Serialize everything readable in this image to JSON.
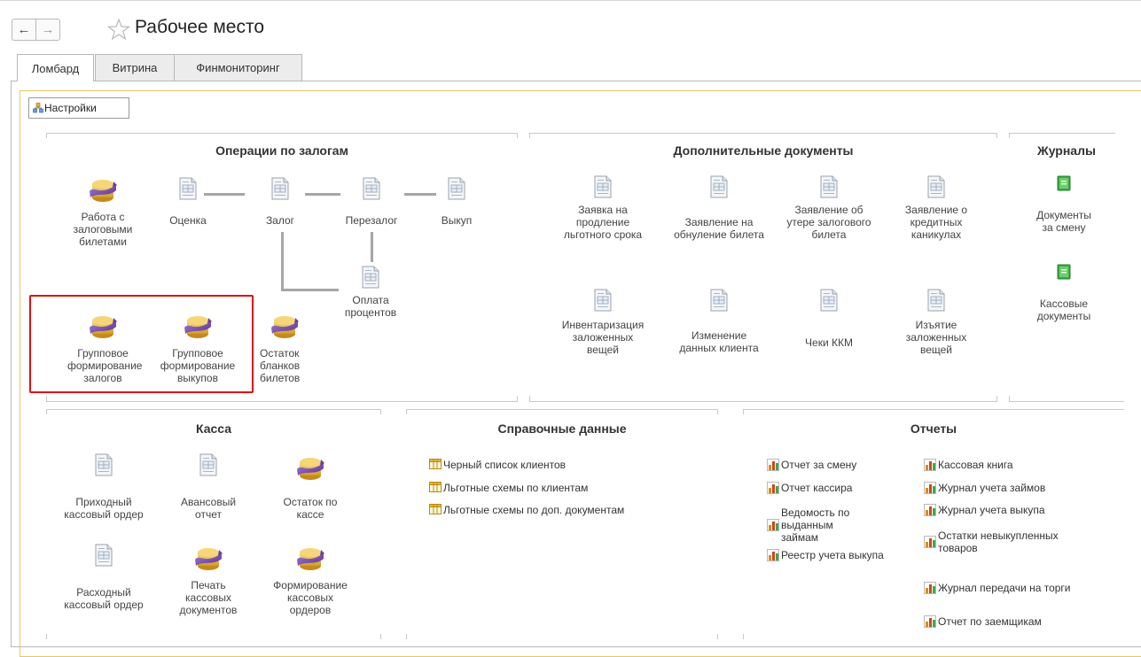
{
  "window": {
    "title": "Рабочее место"
  },
  "tabs": [
    {
      "label": "Ломбард"
    },
    {
      "label": "Витрина"
    },
    {
      "label": "Финмониторинг"
    }
  ],
  "settings_button": "Настройки",
  "operations": {
    "title": "Операции по залогам",
    "items": {
      "work_tickets": "Работа с залоговыми билетами",
      "valuation": "Оценка",
      "pledge": "Залог",
      "repledge": "Перезалог",
      "buyout": "Выкуп",
      "interest_payment": "Оплата процентов",
      "group_pledges": "Групповое формирование залогов",
      "group_buyouts": "Групповое формирование выкупов",
      "blank_remainder": "Остаток бланков билетов"
    }
  },
  "additional_docs": {
    "title": "Дополнительные документы",
    "items": {
      "grace_extension": "Заявка на продление льготного срока",
      "ticket_reset": "Заявление на обнуление билета",
      "ticket_loss": "Заявление об утере залогового билета",
      "credit_holidays": "Заявление о кредитных каникулах",
      "inventory": "Инвентаризация заложенных вещей",
      "client_change": "Изменение данных клиента",
      "kkm_receipts": "Чеки ККМ",
      "seizure": "Изъятие заложенных вещей"
    }
  },
  "journals": {
    "title": "Журналы",
    "items": {
      "shift_docs": "Документы за смену",
      "cash_docs": "Кассовые документы"
    }
  },
  "cash": {
    "title": "Касса",
    "items": {
      "incoming_order": "Приходный кассовый ордер",
      "advance_report": "Авансовый отчет",
      "cash_balance": "Остаток по кассе",
      "outgoing_order": "Расходный кассовый ордер",
      "print_cash_docs": "Печать кассовых документов",
      "form_cash_orders": "Формирование кассовых ордеров"
    }
  },
  "reference": {
    "title": "Справочные данные",
    "links": [
      "Черный список клиентов",
      "Льготные схемы по клиентам",
      "Льготные схемы по доп. документам"
    ]
  },
  "reports": {
    "title": "Отчеты",
    "left": [
      "Отчет за смену",
      "Отчет кассира",
      "Ведомость по выданным займам",
      "Реестр учета выкупа"
    ],
    "right": [
      "Кассовая книга",
      "Журнал учета займов",
      "Журнал учета выкупа",
      "Остатки невыкупленных товаров",
      "Журнал передачи на торги",
      "Отчет по заемщикам"
    ]
  },
  "colors": {
    "highlight_border": "#e01010",
    "frame_yellow": "#e5c866",
    "icon_gold": "#e8b43a",
    "icon_purple": "#7a4aa8",
    "journal_green": "#3fa84a",
    "report_orange": "#e08a1a"
  },
  "icons": {
    "back": "arrow-left-icon",
    "forward": "arrow-right-icon",
    "favorite": "star-icon",
    "settings": "settings-icon",
    "processing": "coins-processing-icon",
    "document": "document-icon",
    "journal": "journal-icon",
    "list": "list-icon",
    "report": "report-icon"
  }
}
